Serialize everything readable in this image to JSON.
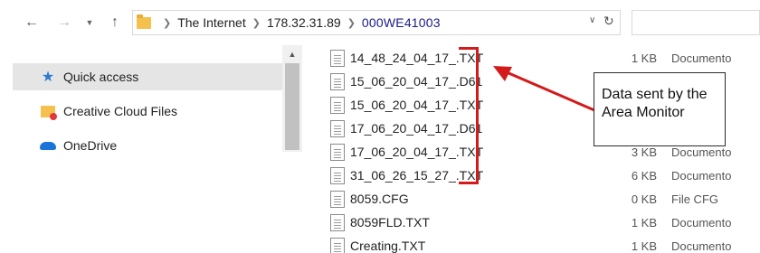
{
  "address_bar": {
    "path": [
      "The Internet",
      "178.32.31.89",
      "000WE41003"
    ]
  },
  "nav_pane": {
    "items": [
      {
        "label": "Quick access",
        "icon": "star-icon"
      },
      {
        "label": "Creative Cloud Files",
        "icon": "creative-cloud-folder-icon"
      },
      {
        "label": "OneDrive",
        "icon": "onedrive-cloud-icon"
      }
    ]
  },
  "files": [
    {
      "name": "14_48_24_04_17_.TXT",
      "size": "1 KB",
      "type": "Documento"
    },
    {
      "name": "15_06_20_04_17_.D61",
      "size": "",
      "type": ""
    },
    {
      "name": "15_06_20_04_17_.TXT",
      "size": "",
      "type": ""
    },
    {
      "name": "17_06_20_04_17_.D61",
      "size": "",
      "type": ""
    },
    {
      "name": "17_06_20_04_17_.TXT",
      "size": "3 KB",
      "type": "Documento"
    },
    {
      "name": "31_06_26_15_27_.TXT",
      "size": "6 KB",
      "type": "Documento"
    },
    {
      "name": "8059.CFG",
      "size": "0 KB",
      "type": "File CFG"
    },
    {
      "name": "8059FLD.TXT",
      "size": "1 KB",
      "type": "Documento"
    },
    {
      "name": "Creating.TXT",
      "size": "1 KB",
      "type": "Documento"
    }
  ],
  "annotation": {
    "callout_text": "Data sent by the Area Monitor",
    "color": "#d41b1b"
  }
}
